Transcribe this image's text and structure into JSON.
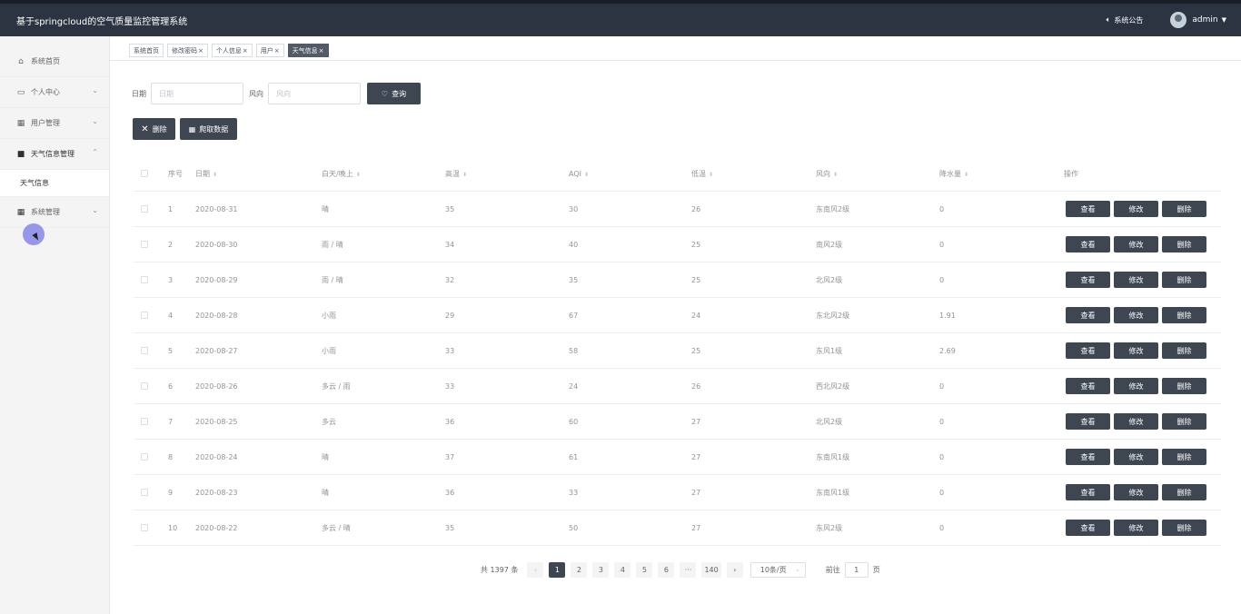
{
  "header": {
    "title": "基于springcloud的空气质量监控管理系统",
    "notice_label": "系统公告",
    "user_label": "admin"
  },
  "sidebar": {
    "items": [
      {
        "label": "系统首页",
        "icon": "home-icon"
      },
      {
        "label": "个人中心",
        "icon": "user-card-icon"
      },
      {
        "label": "用户管理",
        "icon": "grid-icon"
      },
      {
        "label": "天气信息管理",
        "icon": "briefcase-icon"
      },
      {
        "label": "系统管理",
        "icon": "grid-icon"
      }
    ],
    "sub_item": "天气信息"
  },
  "tabs": [
    {
      "label": "系统首页",
      "closable": false
    },
    {
      "label": "修改密码",
      "closable": true
    },
    {
      "label": "个人信息",
      "closable": true
    },
    {
      "label": "用户",
      "closable": true
    },
    {
      "label": "天气信息",
      "closable": true,
      "active": true
    }
  ],
  "filters": {
    "date_label": "日期",
    "date_placeholder": "日期",
    "wind_label": "风向",
    "wind_placeholder": "风向",
    "query_label": "查询"
  },
  "actions": {
    "delete_label": "删除",
    "crawl_label": "爬取数据"
  },
  "table": {
    "headers": {
      "index": "序号",
      "date": "日期",
      "daynight": "白天/晚上",
      "high": "高温",
      "aqi": "AQI",
      "low": "低温",
      "wind": "风向",
      "rain": "降水量",
      "ops": "操作"
    },
    "op_labels": {
      "view": "查看",
      "edit": "修改",
      "delete": "删除"
    },
    "rows": [
      {
        "index": "1",
        "date": "2020-08-31",
        "daynight": "晴",
        "high": "35",
        "aqi": "30",
        "low": "26",
        "wind": "东南风2级",
        "rain": "0"
      },
      {
        "index": "2",
        "date": "2020-08-30",
        "daynight": "雨 / 晴",
        "high": "34",
        "aqi": "40",
        "low": "25",
        "wind": "南风2级",
        "rain": "0"
      },
      {
        "index": "3",
        "date": "2020-08-29",
        "daynight": "雨 / 晴",
        "high": "32",
        "aqi": "35",
        "low": "25",
        "wind": "北风2级",
        "rain": "0"
      },
      {
        "index": "4",
        "date": "2020-08-28",
        "daynight": "小雨",
        "high": "29",
        "aqi": "67",
        "low": "24",
        "wind": "东北风2级",
        "rain": "1.91"
      },
      {
        "index": "5",
        "date": "2020-08-27",
        "daynight": "小雨",
        "high": "33",
        "aqi": "58",
        "low": "25",
        "wind": "东风1级",
        "rain": "2.69"
      },
      {
        "index": "6",
        "date": "2020-08-26",
        "daynight": "多云 / 雨",
        "high": "33",
        "aqi": "24",
        "low": "26",
        "wind": "西北风2级",
        "rain": "0"
      },
      {
        "index": "7",
        "date": "2020-08-25",
        "daynight": "多云",
        "high": "36",
        "aqi": "60",
        "low": "27",
        "wind": "北风2级",
        "rain": "0"
      },
      {
        "index": "8",
        "date": "2020-08-24",
        "daynight": "晴",
        "high": "37",
        "aqi": "61",
        "low": "27",
        "wind": "东南风1级",
        "rain": "0"
      },
      {
        "index": "9",
        "date": "2020-08-23",
        "daynight": "晴",
        "high": "36",
        "aqi": "33",
        "low": "27",
        "wind": "东南风1级",
        "rain": "0"
      },
      {
        "index": "10",
        "date": "2020-08-22",
        "daynight": "多云 / 晴",
        "high": "35",
        "aqi": "50",
        "low": "27",
        "wind": "东风2级",
        "rain": "0"
      }
    ]
  },
  "pagination": {
    "total_text": "共 1397 条",
    "pages": [
      "1",
      "2",
      "3",
      "4",
      "5",
      "6",
      "···",
      "140"
    ],
    "current": "1",
    "prev": "‹",
    "next": "›",
    "page_size": "10条/页",
    "goto_label": "前往",
    "goto_value": "1",
    "page_suffix": "页"
  }
}
